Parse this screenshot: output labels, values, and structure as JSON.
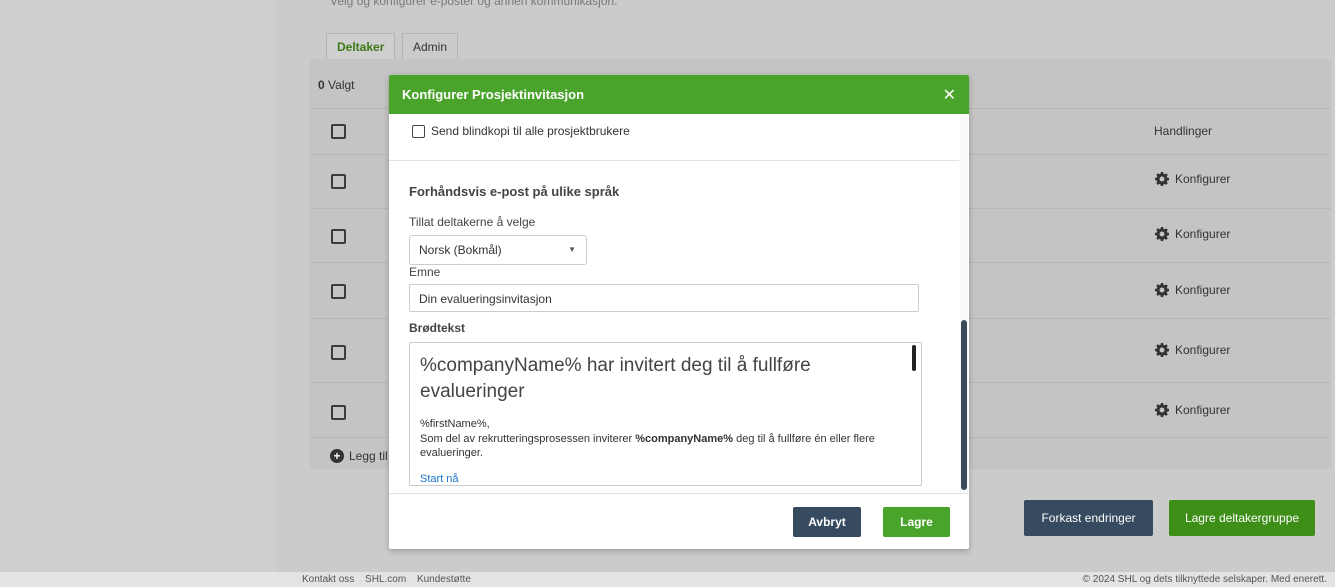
{
  "background": {
    "intro_text": "Velg og konfigurer e-poster og annen kommunikasjon.",
    "tabs": [
      {
        "label": "Deltaker",
        "active": true
      },
      {
        "label": "Admin",
        "active": false
      }
    ],
    "selected_count": "0",
    "selected_label": "Valgt",
    "actions_header": "Handlinger",
    "row_action_label": "Konfigurer",
    "add_row_label": "Legg til",
    "discard_button": "Forkast endringer",
    "save_group_button": "Lagre deltakergruppe"
  },
  "modal": {
    "title": "Konfigurer Prosjektinvitasjon",
    "bcc_label": "Send blindkopi til alle prosjektbrukere",
    "section_title": "Forhåndsvis e-post på ulike språk",
    "allow_label": "Tillat deltakerne å velge",
    "language_value": "Norsk (Bokmål)",
    "subject_label": "Emne",
    "subject_value": "Din evalueringsinvitasjon",
    "body_label": "Brødtekst",
    "body_heading": "%companyName% har invitert deg til å fullføre evalueringer",
    "body_greeting": "%firstName%,",
    "body_para_prefix": "Som del av rekrutteringsprosessen inviterer ",
    "body_para_bold": "%companyName%",
    "body_para_suffix": " deg til å fullføre én eller flere evalueringer.",
    "body_link": "Start nå",
    "cancel_button": "Avbryt",
    "save_button": "Lagre"
  },
  "footer": {
    "links": [
      "Kontakt oss",
      "SHL.com",
      "Kundestøtte"
    ],
    "copyright": "© 2024 SHL og dets tilknyttede selskaper. Med enerett."
  },
  "colors": {
    "brand_green": "#4aa42b",
    "dark_button": "#364a60",
    "link": "#1a73c8"
  }
}
